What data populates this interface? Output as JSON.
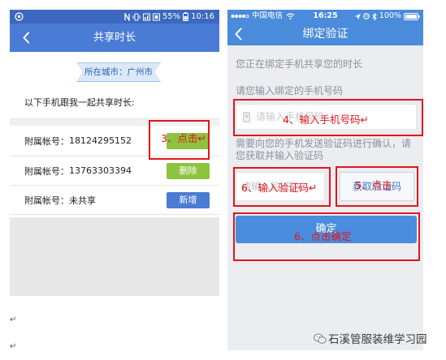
{
  "left_screen": {
    "status_bar": {
      "battery": "55%",
      "time": "10:16",
      "icons": [
        "app-notification-icon",
        "nfc-icon",
        "vibrate-icon",
        "signal-icon",
        "sim-card-icon",
        "battery-icon"
      ]
    },
    "header": {
      "title": "共享时长",
      "back_icon": "back-arrow-icon"
    },
    "city_label": "所在城市：广州市",
    "intro": "以下手机跟我一起共享时长:",
    "accounts": [
      {
        "label": "附属帐号：",
        "value": "18124295152"
      },
      {
        "label": "附属帐号：",
        "value": "13763303394",
        "button": "删除"
      },
      {
        "label": "附属帐号：",
        "value": "未共享",
        "button": "新增"
      }
    ]
  },
  "right_screen": {
    "status_bar": {
      "carrier": "中国电信",
      "time": "16:25",
      "battery": "100%",
      "icons": [
        "signal-dots-icon",
        "wifi-icon",
        "location-arrow-icon",
        "alarm-icon",
        "bluetooth-icon",
        "battery-icon"
      ]
    },
    "header": {
      "title": "绑定验证",
      "back_icon": "back-arrow-icon"
    },
    "notice": "您正在绑定手机共享您的时长",
    "phone_prompt": "请您输入绑定的手机号码",
    "phone_input": {
      "placeholder": "请输入手机号码",
      "icon": "phone-icon"
    },
    "code_hint": "需要向您的手机发送验证码进行确认，请您获取并输入验证码",
    "code_input": {
      "placeholder": "请输入验证码"
    },
    "get_code_button": "获取验证码",
    "confirm_button": "确定"
  },
  "annotations": [
    {
      "text": "3、点击↵"
    },
    {
      "text": "4、输入手机号码↵"
    },
    {
      "text": "6、输入验证码↵"
    },
    {
      "text": "5、点击"
    },
    {
      "text": "6、点击确定"
    }
  ],
  "document": {
    "paragraph_marks": [
      "↵",
      "↵"
    ],
    "watermark": "石溪管服装维学习园",
    "watermark_icon": "wechat-icon"
  },
  "colors": {
    "left_status": "#3c68bf",
    "left_header": "#4a7bd5",
    "right_bar": "#4a8bdb",
    "green": "#8cc43e",
    "add_blue": "#4a7bd5",
    "confirm_blue": "#4a8cdd",
    "red": "#e3151b",
    "link_blue": "#3b78d2"
  }
}
